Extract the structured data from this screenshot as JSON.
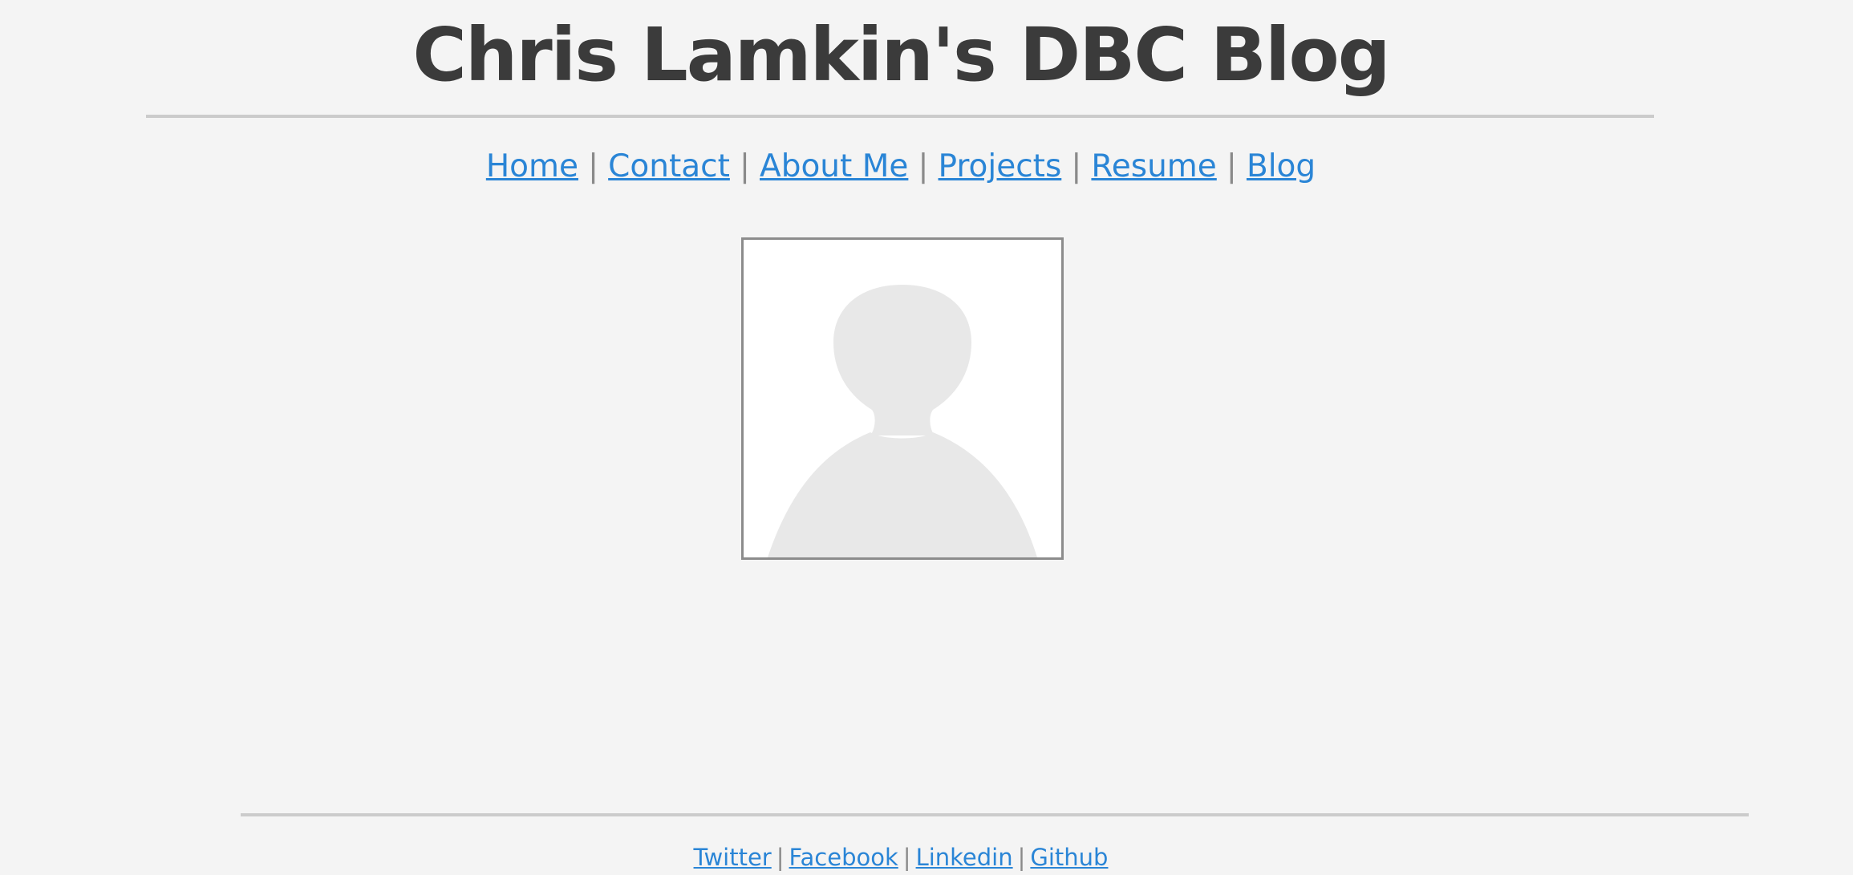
{
  "header": {
    "title": "Chris Lamkin's DBC Blog"
  },
  "nav": {
    "separator": "|",
    "items": [
      {
        "label": "Home"
      },
      {
        "label": "Contact"
      },
      {
        "label": "About Me"
      },
      {
        "label": "Projects"
      },
      {
        "label": "Resume"
      },
      {
        "label": "Blog"
      }
    ]
  },
  "profile": {
    "icon": "avatar-placeholder-icon"
  },
  "footer": {
    "separator": "|",
    "links": [
      {
        "label": "Twitter"
      },
      {
        "label": "Facebook"
      },
      {
        "label": "Linkedin"
      },
      {
        "label": "Github"
      }
    ]
  },
  "colors": {
    "background": "#f4f4f4",
    "title": "#3b3b3b",
    "link": "#2a85d6",
    "separator": "#8a8a8a",
    "rule": "#cbcbcb",
    "avatar_border": "#8c8c8c",
    "avatar_silhouette": "#e8e8e8"
  }
}
